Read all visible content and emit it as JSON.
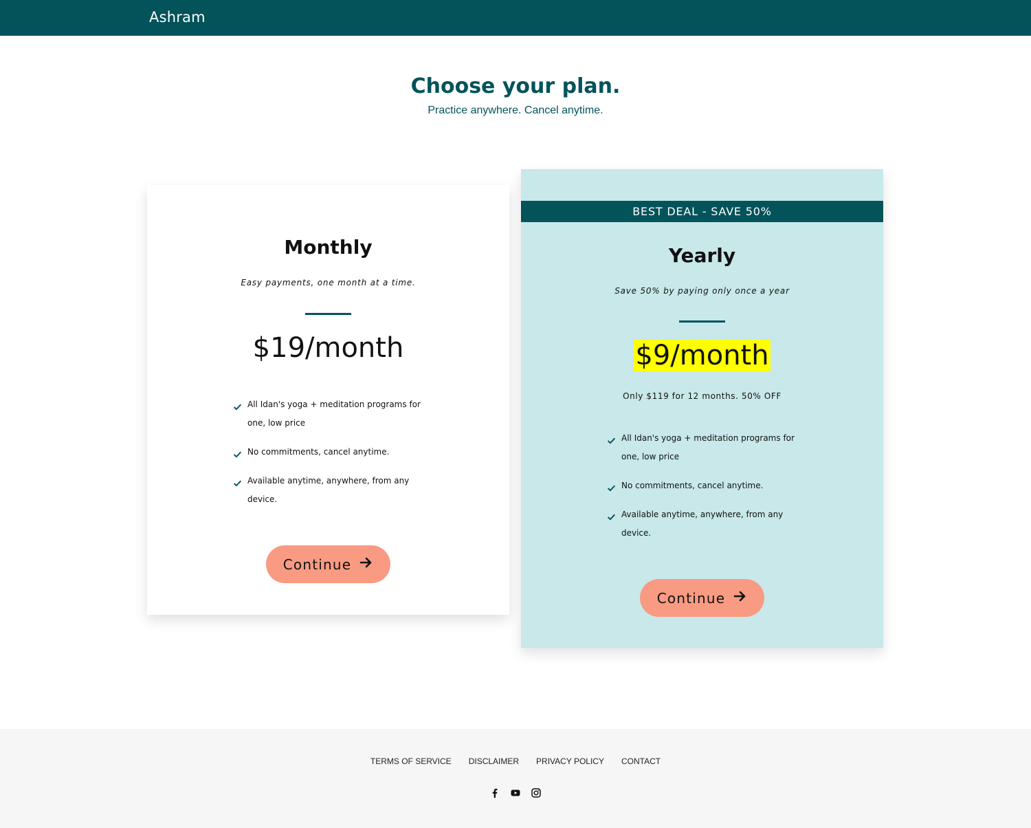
{
  "header": {
    "brand": "Ashram"
  },
  "hero": {
    "title": "Choose your plan.",
    "subtitle": "Practice anywhere. Cancel anytime."
  },
  "plans": {
    "monthly": {
      "name": "Monthly",
      "description": "Easy payments, one month at a time.",
      "price": "$19/month",
      "features": [
        "All Idan's yoga + meditation programs for one, low price",
        "No commitments, cancel anytime.",
        "Available anytime, anywhere, from any device."
      ],
      "cta": "Continue"
    },
    "yearly": {
      "badge": "BEST DEAL - SAVE 50%",
      "name": "Yearly",
      "description": "Save 50% by paying only once a year",
      "price": "$9/month",
      "price_note": "Only $119 for 12 months. 50% OFF",
      "features": [
        "All Idan's yoga + meditation programs for one, low price",
        "No commitments, cancel anytime.",
        "Available anytime, anywhere, from any device."
      ],
      "cta": "Continue"
    }
  },
  "footer": {
    "links": [
      "TERMS OF SERVICE",
      "DISCLAIMER",
      "PRIVACY POLICY",
      "CONTACT"
    ],
    "social_icons": [
      "facebook-icon",
      "youtube-icon",
      "instagram-icon"
    ]
  },
  "colors": {
    "primary": "#02535a",
    "highlight_card": "#c8e8e9",
    "cta": "#f99a82",
    "price_highlight": "#ffff00",
    "footer_bg": "#f6f6f6"
  }
}
